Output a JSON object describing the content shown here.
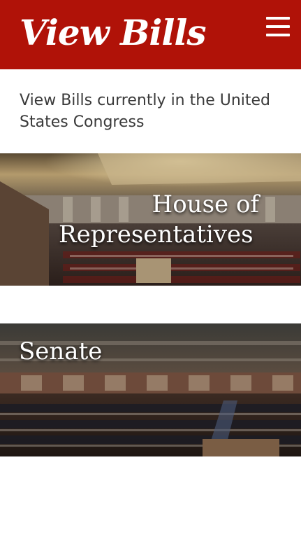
{
  "header": {
    "title": "View Bills",
    "background": "#b01208"
  },
  "intro": {
    "text": "View Bills currently in the United States Congress"
  },
  "chambers": [
    {
      "label_line1": "House of",
      "label_line2": "Representatives"
    },
    {
      "label": "Senate"
    }
  ],
  "icons": {
    "menu": "hamburger-menu-icon"
  }
}
